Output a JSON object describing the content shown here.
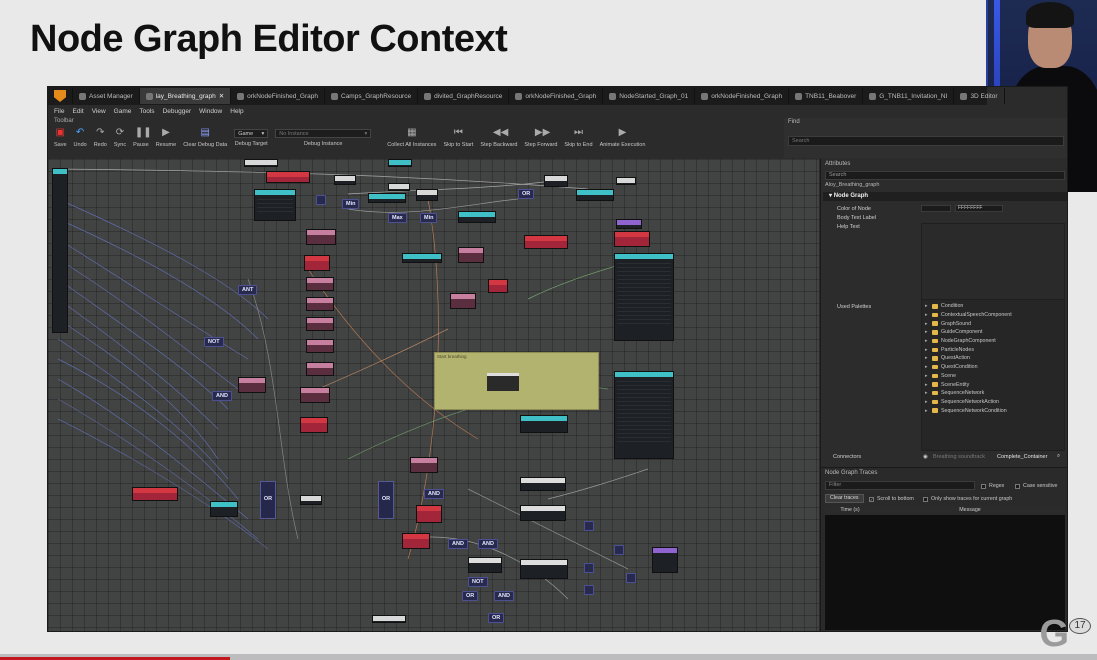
{
  "slide": {
    "title": "Node Graph Editor Context",
    "logo_number": "17"
  },
  "tabs": [
    {
      "label": "Asset Manager",
      "icon": "asset-manager-icon",
      "active": false
    },
    {
      "label": "lay_Breathing_graph",
      "active": true
    },
    {
      "label": "orkNodeFinished_Graph",
      "active": false
    },
    {
      "label": "Camps_GraphResource",
      "active": false
    },
    {
      "label": "divited_GraphResource",
      "active": false
    },
    {
      "label": "orkNodeFinished_Graph",
      "active": false
    },
    {
      "label": "NodeStarted_Graph_01",
      "active": false
    },
    {
      "label": "orkNodeFinished_Graph",
      "active": false
    },
    {
      "label": "TNB11_Beabover",
      "active": false
    },
    {
      "label": "G_TNB11_Invitation_NI",
      "active": false
    },
    {
      "label": "3D Editor",
      "active": false
    }
  ],
  "menu": [
    "File",
    "Edit",
    "View",
    "Game",
    "Tools",
    "Debugger",
    "Window",
    "Help"
  ],
  "toolbar": {
    "caption": "Toolbar",
    "buttons": [
      {
        "label": "Save",
        "icon": "save-icon"
      },
      {
        "label": "Undo",
        "icon": "undo-icon"
      },
      {
        "label": "Redo",
        "icon": "redo-icon"
      },
      {
        "label": "Sync",
        "icon": "sync-icon"
      },
      {
        "label": "Pause",
        "icon": "pause-icon"
      },
      {
        "label": "Resume",
        "icon": "resume-icon"
      },
      {
        "label": "Clear Debug Data",
        "icon": "clear-debug-icon"
      }
    ],
    "debug_target_value": "Game",
    "debug_target_label": "Debug Target",
    "debug_instance_value": "No Instance",
    "debug_instance_label": "Debug Instance",
    "right_buttons": [
      {
        "label": "Collect All Instances",
        "icon": "collect-icon"
      },
      {
        "label": "Skip to Start",
        "icon": "skip-start-icon"
      },
      {
        "label": "Step Backward",
        "icon": "step-back-icon"
      },
      {
        "label": "Step Forward",
        "icon": "step-forward-icon"
      },
      {
        "label": "Skip to End",
        "icon": "skip-end-icon"
      },
      {
        "label": "Animate Execution",
        "icon": "animate-icon"
      }
    ]
  },
  "find": {
    "title": "Find",
    "placeholder": "Search"
  },
  "canvas": {
    "comment_title": "Start breathing",
    "logic_labels": [
      "Min",
      "Min",
      "Max",
      "Min",
      "OR",
      "ANT",
      "NOT",
      "AND",
      "OR",
      "OR",
      "AND",
      "AND",
      "AND",
      "NOT",
      "OR",
      "AND",
      "OR"
    ]
  },
  "attributes": {
    "title": "Attributes",
    "search_value": "Search",
    "asset_name": "Aloy_Breathing_graph",
    "section": "Node Graph",
    "color_of_node_label": "Color of Node",
    "color_of_node_value": "FFFFFFFF",
    "body_text_label_label": "Body Text Label",
    "help_text_label": "Help Text",
    "palettes_label": "Used Palettes",
    "palettes": [
      "Condition",
      "ContextualSpeechComponent",
      "GraphSound",
      "GuideComponent",
      "NodeGraphComponent",
      "ParticleNodes",
      "QuestAction",
      "QuestCondition",
      "Scene",
      "SceneEntity",
      "SequenceNetwork",
      "SequenceNetworkAction",
      "SequenceNetworkCondition"
    ],
    "connectors_label": "Connectors",
    "connectors_value": "Breathing soundtrack",
    "connectors_link": "Complete_Container"
  },
  "traces": {
    "title": "Node Graph Traces",
    "filter_placeholder": "Filter",
    "regex_label": "Regex",
    "case_label": "Case sensitive",
    "clear_button": "Clear traces",
    "scroll_label": "Scroll to bottom",
    "only_current_label": "Only show traces for current graph",
    "col_time": "Time (s)",
    "col_message": "Message"
  },
  "colors": {
    "teal_node": "#3fbfc6",
    "red_node": "#d23742",
    "comment_box": "#b3b370",
    "logic_node": "#27294d"
  }
}
